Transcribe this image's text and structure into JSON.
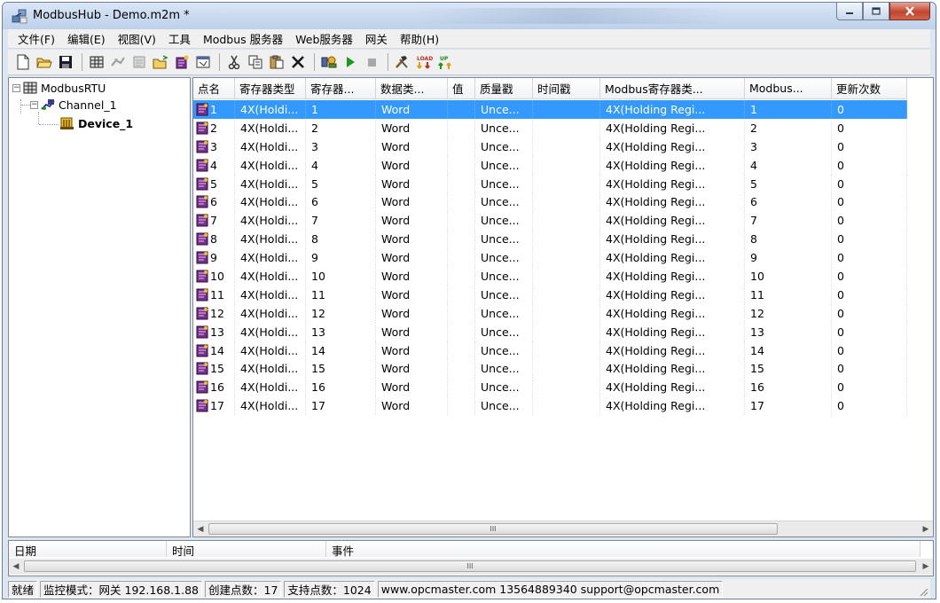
{
  "window": {
    "title": "ModbusHub - Demo.m2m *"
  },
  "menu": [
    "文件(F)",
    "编辑(E)",
    "视图(V)",
    "工具",
    "Modbus 服务器",
    "Web服务器",
    "网关",
    "帮助(H)"
  ],
  "tree": {
    "root": "ModbusRTU",
    "channel": "Channel_1",
    "device": "Device_1"
  },
  "grid": {
    "columns": [
      "点名",
      "寄存器类型",
      "寄存器...",
      "数据类...",
      "值",
      "质量戳",
      "时间戳",
      "Modbus寄存器类...",
      "Modbus...",
      "更新次数"
    ],
    "rows": [
      [
        "1",
        "4X(Holdi...",
        "1",
        "Word",
        "",
        "Unce...",
        "",
        "4X(Holding Regi...",
        "1",
        "0"
      ],
      [
        "2",
        "4X(Holdi...",
        "2",
        "Word",
        "",
        "Unce...",
        "",
        "4X(Holding Regi...",
        "2",
        "0"
      ],
      [
        "3",
        "4X(Holdi...",
        "3",
        "Word",
        "",
        "Unce...",
        "",
        "4X(Holding Regi...",
        "3",
        "0"
      ],
      [
        "4",
        "4X(Holdi...",
        "4",
        "Word",
        "",
        "Unce...",
        "",
        "4X(Holding Regi...",
        "4",
        "0"
      ],
      [
        "5",
        "4X(Holdi...",
        "5",
        "Word",
        "",
        "Unce...",
        "",
        "4X(Holding Regi...",
        "5",
        "0"
      ],
      [
        "6",
        "4X(Holdi...",
        "6",
        "Word",
        "",
        "Unce...",
        "",
        "4X(Holding Regi...",
        "6",
        "0"
      ],
      [
        "7",
        "4X(Holdi...",
        "7",
        "Word",
        "",
        "Unce...",
        "",
        "4X(Holding Regi...",
        "7",
        "0"
      ],
      [
        "8",
        "4X(Holdi...",
        "8",
        "Word",
        "",
        "Unce...",
        "",
        "4X(Holding Regi...",
        "8",
        "0"
      ],
      [
        "9",
        "4X(Holdi...",
        "9",
        "Word",
        "",
        "Unce...",
        "",
        "4X(Holding Regi...",
        "9",
        "0"
      ],
      [
        "10",
        "4X(Holdi...",
        "10",
        "Word",
        "",
        "Unce...",
        "",
        "4X(Holding Regi...",
        "10",
        "0"
      ],
      [
        "11",
        "4X(Holdi...",
        "11",
        "Word",
        "",
        "Unce...",
        "",
        "4X(Holding Regi...",
        "11",
        "0"
      ],
      [
        "12",
        "4X(Holdi...",
        "12",
        "Word",
        "",
        "Unce...",
        "",
        "4X(Holding Regi...",
        "12",
        "0"
      ],
      [
        "13",
        "4X(Holdi...",
        "13",
        "Word",
        "",
        "Unce...",
        "",
        "4X(Holding Regi...",
        "13",
        "0"
      ],
      [
        "14",
        "4X(Holdi...",
        "14",
        "Word",
        "",
        "Unce...",
        "",
        "4X(Holding Regi...",
        "14",
        "0"
      ],
      [
        "15",
        "4X(Holdi...",
        "15",
        "Word",
        "",
        "Unce...",
        "",
        "4X(Holding Regi...",
        "15",
        "0"
      ],
      [
        "16",
        "4X(Holdi...",
        "16",
        "Word",
        "",
        "Unce...",
        "",
        "4X(Holding Regi...",
        "16",
        "0"
      ],
      [
        "17",
        "4X(Holdi...",
        "17",
        "Word",
        "",
        "Unce...",
        "",
        "4X(Holding Regi...",
        "17",
        "0"
      ]
    ],
    "selected_row": 0,
    "scroll_glyph": "III"
  },
  "log": {
    "columns": [
      "日期",
      "时间",
      "事件"
    ],
    "scroll_glyph": "III"
  },
  "status": {
    "ready": "就绪",
    "mode": "监控模式：网关 192.168.1.88",
    "created": "创建点数：17",
    "supported": "支持点数：1024",
    "contact": "www.opcmaster.com 13564889340 support@opcmaster.com"
  },
  "colors": {
    "selection": "#3399ff",
    "tag_icon": "#7a2f8e",
    "title_gradient_top": "#d9e6f6"
  },
  "icons": {
    "toolbar": [
      "new-file-icon",
      "open-folder-icon",
      "save-icon",
      "add-channel-icon",
      "add-device-icon",
      "add-tags-icon",
      "import-icon",
      "export-icon",
      "properties-icon",
      "cut-icon",
      "copy-icon",
      "paste-icon",
      "delete-icon",
      "monitor-icon",
      "run-icon",
      "stop-icon",
      "tools-icon",
      "load-icon",
      "upload-icon"
    ]
  }
}
